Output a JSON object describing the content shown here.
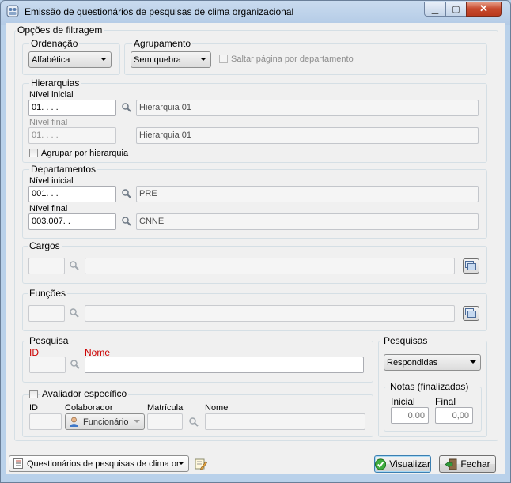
{
  "window": {
    "title": "Emissão de questionários de pesquisas de clima organizacional",
    "min_glyph": "▁",
    "max_glyph": "▢",
    "close_glyph": "✕"
  },
  "filters": {
    "title": "Opções de filtragem",
    "ordenacao": {
      "label": "Ordenação",
      "value": "Alfabética"
    },
    "agrupamento": {
      "label": "Agrupamento",
      "value": "Sem quebra",
      "saltar_label": "Saltar página por departamento"
    },
    "hierarquias": {
      "title": "Hierarquias",
      "inicial_label": "Nível inicial",
      "inicial_value": "01.   .   .   .",
      "inicial_desc": "Hierarquia 01",
      "final_label": "Nível final",
      "final_value": "01.   .   .   .",
      "final_desc": "Hierarquia 01",
      "agrupar_label": "Agrupar por hierarquia"
    },
    "departamentos": {
      "title": "Departamentos",
      "inicial_label": "Nível inicial",
      "inicial_value": "001.   .   .",
      "inicial_desc": "PRE",
      "final_label": "Nível final",
      "final_value": "003.007.   .",
      "final_desc": "CNNE"
    },
    "cargos": {
      "title": "Cargos"
    },
    "funcoes": {
      "title": "Funções"
    },
    "pesquisa": {
      "title": "Pesquisa",
      "id_label": "ID",
      "nome_label": "Nome"
    },
    "pesquisas": {
      "title": "Pesquisas",
      "value": "Respondidas"
    },
    "notas": {
      "title": "Notas (finalizadas)",
      "inicial_label": "Inicial",
      "inicial_value": "0,00",
      "final_label": "Final",
      "final_value": "0,00"
    },
    "avaliador": {
      "title": "Avaliador específico",
      "id_label": "ID",
      "colaborador_label": "Colaborador",
      "colaborador_value": "Funcionário",
      "matricula_label": "Matrícula",
      "nome_label": "Nome"
    }
  },
  "footer": {
    "report_value": "Questionários de pesquisas de clima or",
    "visualizar_label": "Visualizar",
    "fechar_label": "Fechar"
  },
  "colors": {
    "required": "#cc0000",
    "client_bg": "#f0f0f0",
    "frame": "#b9d1ea"
  }
}
